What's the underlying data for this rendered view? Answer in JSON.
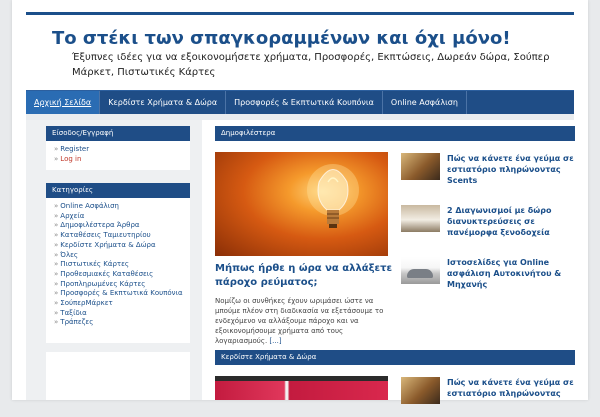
{
  "site": {
    "title": "Το στέκι των σπαγκοραμμένων και όχι μόνο!",
    "description": "Έξυπνες ιδέες για να εξοικονομήσετε χρήματα, Προσφορές, Εκπτώσεις, Δωρεάν δώρα, Σούπερ Μάρκετ, Πιστωτικές Κάρτες"
  },
  "nav": {
    "items": [
      "Αρχική Σελίδα",
      "Κερδίστε Χρήματα & Δώρα",
      "Προσφορές & Εκπτωτικά Κουπόνια",
      "Online Ασφάλιση"
    ]
  },
  "sidebar": {
    "login": {
      "title": "Είσοδος/Εγγραφή",
      "items": [
        "Register",
        "Log in"
      ]
    },
    "categories": {
      "title": "Κατηγορίες",
      "items": [
        "Online Ασφάλιση",
        "Αρχεία",
        "Δημοφιλέστερα Άρθρα",
        "Καταθέσεις Ταμιευτηρίου",
        "Κερδίστε Χρήματα & Δώρα",
        "Όλες",
        "Πιστωτικές Κάρτες",
        "Προθεσμιακές Καταθέσεις",
        "Προπληρωμένες Κάρτες",
        "Προσφορές & Εκπτωτικά Κουπόνια",
        "ΣούπερΜάρκετ",
        "Ταξίδια",
        "Τράπεζες"
      ]
    }
  },
  "main": {
    "section1": {
      "title": "Δημοφιλέστερα",
      "featured": {
        "title": "Μήπως ήρθε η ώρα να αλλάξετε πάροχο ρεύματος;",
        "excerpt": "Νομίζω οι συνθήκες έχουν ωριμάσει ώστε να μπούμε πλέον στη διαδικασία να εξετάσουμε το ενδεχόμενο να αλλάξουμε πάροχο και να εξοικονομήσουμε χρήματα από τους λογαριασμούς.",
        "more": "[...]"
      },
      "posts": [
        "Πώς να κάνετε ένα γεύμα σε εστιατόριο πληρώνοντας Scents",
        "2 Διαγωνισμοί με δώρο διανυκτερεύσεις σε πανέμορφα ξενοδοχεία",
        "Ιστοσελίδες για Online ασφάλιση Αυτοκινήτου & Μηχανής"
      ]
    },
    "section2": {
      "title": "Κερδίστε Χρήματα & Δώρα",
      "posts": [
        "Πώς να κάνετε ένα γεύμα σε εστιατόριο πληρώνοντας"
      ]
    }
  },
  "colors": {
    "accent": "#1b4f8a",
    "nav_bg": "#1f4d86"
  }
}
